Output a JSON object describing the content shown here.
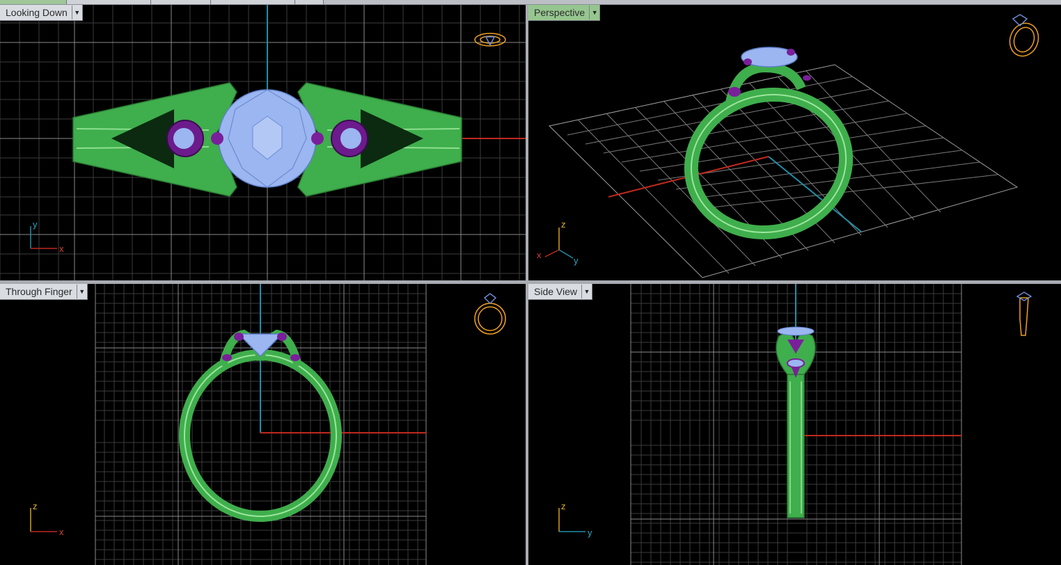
{
  "tabs": [
    "",
    "",
    "",
    "",
    ""
  ],
  "viewports": {
    "top_left": {
      "label": "Looking Down",
      "active": false,
      "axes": {
        "vertical": "y",
        "horizontal": "x"
      }
    },
    "top_right": {
      "label": "Perspective",
      "active": true,
      "axes": {
        "up": "z",
        "left": "x",
        "right": "y"
      }
    },
    "bottom_left": {
      "label": "Through Finger",
      "active": false,
      "axes": {
        "vertical": "z",
        "horizontal": "x"
      }
    },
    "bottom_right": {
      "label": "Side View",
      "active": false,
      "axes": {
        "vertical": "z",
        "horizontal": "y"
      }
    }
  },
  "icons": {
    "dropdown": "triangle-down-icon",
    "view_cube": "ring-orientation-icon"
  },
  "colors": {
    "ring_metal": "#4dbd5a",
    "gem_center": "#9fb9f2",
    "gem_side": "#7a1f9a",
    "grid": "#5a5a5a",
    "grid_major": "#8c8c8c",
    "x_axis": "#c0291f",
    "y_axis": "#1f8fa8",
    "orientation_icon": "#f0a020",
    "active_label": "#96c68f"
  }
}
